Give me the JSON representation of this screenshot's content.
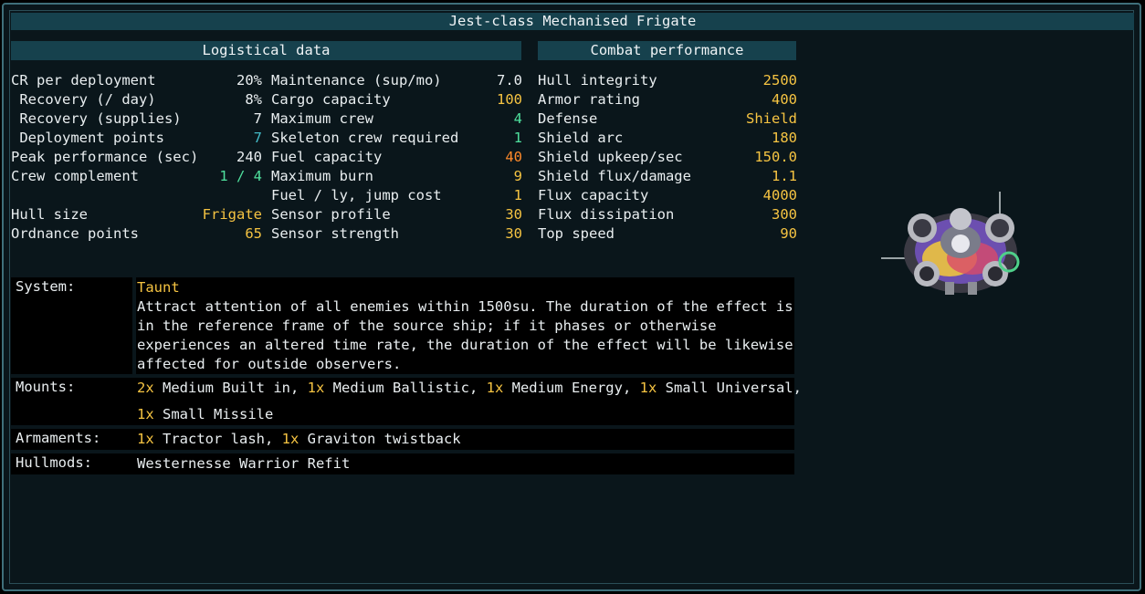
{
  "title": "Jest-class Mechanised Frigate",
  "headers": {
    "logistical": "Logistical data",
    "combat": "Combat performance"
  },
  "col1": [
    {
      "label": "CR per deployment",
      "value": "20%",
      "color": "w"
    },
    {
      "label": " Recovery (/ day)",
      "value": "8%",
      "color": "w"
    },
    {
      "label": " Recovery (supplies)",
      "value": "7",
      "color": "w"
    },
    {
      "label": " Deployment points",
      "value": "7",
      "color": "t"
    },
    {
      "label": "Peak performance (sec)",
      "value": "240",
      "color": "w"
    },
    {
      "label": "Crew complement",
      "value": "1 / 4",
      "color": "g"
    },
    {
      "label": "",
      "value": "",
      "color": "w"
    },
    {
      "label": "Hull size",
      "value": "Frigate",
      "color": "y"
    },
    {
      "label": "Ordnance points",
      "value": "65",
      "color": "y"
    }
  ],
  "col2": [
    {
      "label": "Maintenance (sup/mo)",
      "value": "7.0",
      "color": "w"
    },
    {
      "label": "Cargo capacity",
      "value": "100",
      "color": "y"
    },
    {
      "label": "Maximum crew",
      "value": "4",
      "color": "g"
    },
    {
      "label": "Skeleton crew required",
      "value": "1",
      "color": "g"
    },
    {
      "label": "Fuel capacity",
      "value": "40",
      "color": "o"
    },
    {
      "label": "Maximum burn",
      "value": "9",
      "color": "y"
    },
    {
      "label": "Fuel / ly, jump cost",
      "value": "1",
      "color": "y"
    },
    {
      "label": "Sensor profile",
      "value": "30",
      "color": "y"
    },
    {
      "label": "Sensor strength",
      "value": "30",
      "color": "y"
    }
  ],
  "col3": [
    {
      "label": "Hull integrity",
      "value": "2500",
      "color": "y"
    },
    {
      "label": "Armor rating",
      "value": "400",
      "color": "y"
    },
    {
      "label": "Defense",
      "value": "Shield",
      "color": "y"
    },
    {
      "label": "Shield arc",
      "value": "180",
      "color": "y"
    },
    {
      "label": "Shield upkeep/sec",
      "value": "150.0",
      "color": "y"
    },
    {
      "label": "Shield flux/damage",
      "value": "1.1",
      "color": "y"
    },
    {
      "label": "Flux capacity",
      "value": "4000",
      "color": "y"
    },
    {
      "label": "Flux dissipation",
      "value": "300",
      "color": "y"
    },
    {
      "label": "Top speed",
      "value": "90",
      "color": "y"
    }
  ],
  "system": {
    "label": "System:",
    "name": "Taunt",
    "lines": [
      "Attract attention of all enemies within 1500su. The duration of the effect is",
      "in the reference frame of the source ship; if it phases or otherwise",
      "experiences an altered time rate, the duration of the effect will be likewise",
      "affected for outside observers."
    ]
  },
  "mounts": {
    "label": "Mounts:",
    "line1": [
      {
        "count": "2x",
        "text": " Medium Built in, "
      },
      {
        "count": "1x",
        "text": " Medium Ballistic, "
      },
      {
        "count": "1x",
        "text": " Medium Energy, "
      },
      {
        "count": "1x",
        "text": " Small Universal,"
      }
    ],
    "line2": [
      {
        "count": "1x",
        "text": " Small Missile"
      }
    ]
  },
  "armaments": {
    "label": "Armaments:",
    "items": [
      {
        "count": "1x",
        "text": " Tractor lash, "
      },
      {
        "count": "1x",
        "text": " Graviton twistback"
      }
    ]
  },
  "hullmods": {
    "label": "Hullmods:",
    "text": "Westernesse Warrior Refit"
  }
}
